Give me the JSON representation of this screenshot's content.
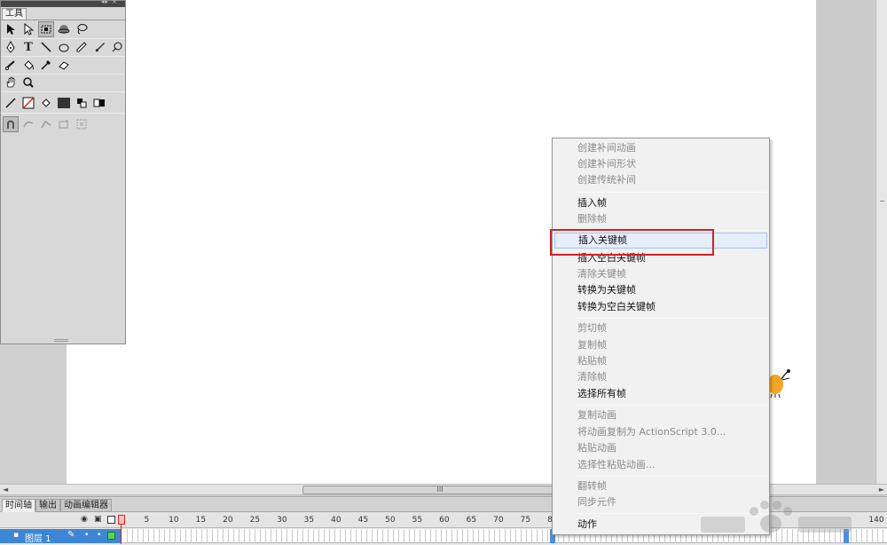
{
  "tools_panel": {
    "tab_label": "工具",
    "dock_glyph": "◂▸ ×"
  },
  "context_menu": {
    "items": [
      {
        "label": "创建补间动画",
        "enabled": false
      },
      {
        "label": "创建补间形状",
        "enabled": false
      },
      {
        "label": "创建传统补间",
        "enabled": false
      },
      {
        "label": "插入帧",
        "enabled": true
      },
      {
        "label": "删除帧",
        "enabled": false
      },
      {
        "label": "插入关键帧",
        "enabled": true,
        "highlighted": true
      },
      {
        "label": "插入空白关键帧",
        "enabled": true
      },
      {
        "label": "清除关键帧",
        "enabled": false
      },
      {
        "label": "转换为关键帧",
        "enabled": true
      },
      {
        "label": "转换为空白关键帧",
        "enabled": true
      },
      {
        "label": "剪切帧",
        "enabled": false
      },
      {
        "label": "复制帧",
        "enabled": false
      },
      {
        "label": "粘贴帧",
        "enabled": false
      },
      {
        "label": "清除帧",
        "enabled": false
      },
      {
        "label": "选择所有帧",
        "enabled": true
      },
      {
        "label": "复制动画",
        "enabled": false
      },
      {
        "label": "将动画复制为 ActionScript 3.0...",
        "enabled": false
      },
      {
        "label": "粘贴动画",
        "enabled": false
      },
      {
        "label": "选择性粘贴动画...",
        "enabled": false
      },
      {
        "label": "翻转帧",
        "enabled": false
      },
      {
        "label": "同步元件",
        "enabled": false
      },
      {
        "label": "动作",
        "enabled": true
      }
    ]
  },
  "timeline": {
    "tabs": [
      "时间轴",
      "输出",
      "动画编辑器"
    ],
    "layer_name": "图层 1",
    "ruler_numbers": [
      "5",
      "10",
      "15",
      "20",
      "25",
      "30",
      "35",
      "40",
      "45",
      "50",
      "55",
      "60",
      "65",
      "70",
      "75",
      "80",
      "140"
    ],
    "header_icons": [
      "eye-icon",
      "lock-icon",
      "outline-icon"
    ]
  },
  "scrollbar": {
    "thumb_label": "III",
    "left_arrow": "◄",
    "right_arrow": "►"
  },
  "colors": {
    "selection_blue": "#3d86d6",
    "highlight_red": "#d72020",
    "creature_orange": "#f5a623"
  }
}
